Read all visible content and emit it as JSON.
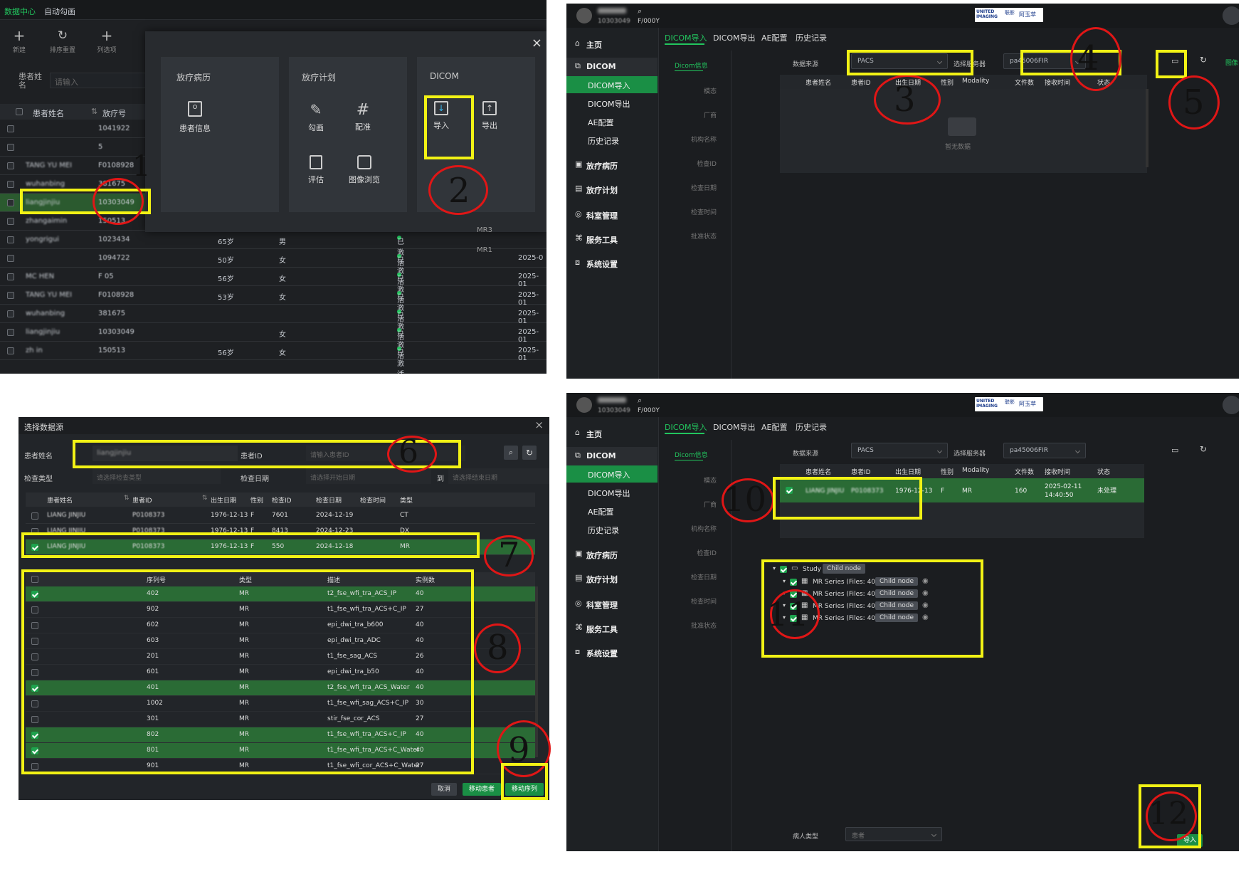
{
  "panel1": {
    "top_tabs": [
      "数据中心",
      "自动勾画"
    ],
    "toolbar": [
      "新建",
      "排序重置",
      "列选项"
    ],
    "search_label": "患者姓名",
    "search_placeholder": "请输入",
    "headers": [
      "患者姓名",
      "放疗号"
    ],
    "rows": [
      {
        "id": "1041922"
      },
      {
        "id": "5"
      },
      {
        "name": "TANG YU MEI",
        "id": "F0108928"
      },
      {
        "name": "wuhanbing",
        "id": "381675"
      },
      {
        "name": "liangjinjiu",
        "id": "10303049"
      },
      {
        "name": "zhangaimin",
        "id": "150513"
      },
      {
        "name": "yongrigui",
        "id": "1023434",
        "age": "65岁",
        "sex": "男",
        "status": "已激活"
      },
      {
        "id": "1094722",
        "age": "50岁",
        "sex": "女",
        "status": "已激活",
        "date": "2025-0"
      },
      {
        "name": "MC HEN",
        "id": "F 05",
        "age": "56岁",
        "sex": "女",
        "status": "已激活",
        "date": "2025-01"
      },
      {
        "name": "TANG YU MEI",
        "id": "F0108928",
        "age": "53岁",
        "sex": "女",
        "status": "已激活",
        "date": "2025-01"
      },
      {
        "name": "wuhanbing",
        "id": "381675",
        "status": "已激活",
        "date": "2025-01"
      },
      {
        "name": "liangjinjiu",
        "id": "10303049",
        "sex": "女",
        "status": "已激活",
        "date": "2025-01"
      },
      {
        "name": "zh in",
        "id": "150513",
        "age": "56岁",
        "sex": "女",
        "status": "已激活",
        "date": "2025-01"
      }
    ],
    "mr_labels": [
      "MR3",
      "MR1"
    ],
    "modal": {
      "close": "×",
      "sections": [
        {
          "title": "放疗病历",
          "items": [
            "患者信息"
          ]
        },
        {
          "title": "放疗计划",
          "items": [
            "勾画",
            "配准",
            "评估",
            "图像浏览"
          ]
        },
        {
          "title": "DICOM",
          "items": [
            "导入",
            "导出"
          ]
        }
      ]
    }
  },
  "app": {
    "user_sub": "10303049",
    "user_sub2": "F/000Y",
    "logo_brand": "UNITED IMAGING",
    "logo_cn": "联影",
    "logo_right": "阿玉苹",
    "nav": [
      "主页",
      "DICOM",
      "DICOM导入",
      "DICOM导出",
      "AE配置",
      "历史记录",
      "放疗病历",
      "放疗计划",
      "科室管理",
      "服务工具",
      "系统设置"
    ],
    "tabs": [
      "DICOM导入",
      "DICOM导出",
      "AE配置",
      "历史记录"
    ],
    "side_tab": "Dicom信息",
    "side_fields": [
      "模态",
      "厂商",
      "机构名称",
      "检查ID",
      "检查日期",
      "检查时间",
      "批准状态"
    ],
    "source_label": "数据来源",
    "source_value": "PACS",
    "server_label": "选择服务器",
    "server_value": "pa45006FIR",
    "right_label": "图像",
    "table_headers": [
      "患者姓名",
      "患者ID",
      "出生日期",
      "性别",
      "Modality",
      "文件数",
      "接收时间",
      "状态"
    ],
    "empty_text": "暂无数据"
  },
  "panel4": {
    "row": {
      "name": "LIANG JINJIU",
      "id": "P0108373",
      "birth": "1976-12-13",
      "sex": "F",
      "modality": "MR",
      "files": "160",
      "recv": "2025-02-11\n14:40:50",
      "status": "未处理"
    },
    "tree": {
      "study": "Study",
      "child": "Child node",
      "series": [
        "MR Series (Files: 40)",
        "MR Series (Files: 40)",
        "MR Series (Files: 40)",
        "MR Series (Files: 40)"
      ]
    },
    "patient_type_label": "病人类型",
    "patient_type_value": "患者",
    "import_button": "导入"
  },
  "dialog": {
    "title": "选择数据源",
    "close": "×",
    "name_label": "患者姓名",
    "name_value": "liangjinjiu",
    "id_label": "患者ID",
    "id_placeholder": "请输入患者ID",
    "type_label": "检查类型",
    "type_placeholder": "请选择检查类型",
    "date_label": "检查日期",
    "date_start": "请选择开始日期",
    "date_to": "到",
    "date_end": "请选择结束日期",
    "study_headers": [
      "患者姓名",
      "患者ID",
      "出生日期",
      "性别",
      "检查ID",
      "检查日期",
      "检查时间",
      "类型"
    ],
    "studies": [
      {
        "name": "LIANG JINJIU",
        "id": "P0108373",
        "birth": "1976-12-13",
        "sex": "F",
        "exam": "7601",
        "date": "2024-12-19",
        "type": "CT",
        "checked": false
      },
      {
        "name": "LIANG JINJIU",
        "id": "P0108373",
        "birth": "1976-12-13",
        "sex": "F",
        "exam": "8413",
        "date": "2024-12-23",
        "type": "DX",
        "checked": false
      },
      {
        "name": "LIANG JINJIU",
        "id": "P0108373",
        "birth": "1976-12-13",
        "sex": "F",
        "exam": "550",
        "date": "2024-12-18",
        "type": "MR",
        "checked": true
      }
    ],
    "series_headers": [
      "序列号",
      "类型",
      "描述",
      "实例数"
    ],
    "series": [
      {
        "no": "402",
        "type": "MR",
        "desc": "t2_fse_wfi_tra_ACS_IP",
        "count": "40",
        "checked": true
      },
      {
        "no": "902",
        "type": "MR",
        "desc": "t1_fse_wfi_tra_ACS+C_IP",
        "count": "27",
        "checked": false
      },
      {
        "no": "602",
        "type": "MR",
        "desc": "epi_dwi_tra_b600",
        "count": "40",
        "checked": false
      },
      {
        "no": "603",
        "type": "MR",
        "desc": "epi_dwi_tra_ADC",
        "count": "40",
        "checked": false
      },
      {
        "no": "201",
        "type": "MR",
        "desc": "t1_fse_sag_ACS",
        "count": "26",
        "checked": false
      },
      {
        "no": "601",
        "type": "MR",
        "desc": "epi_dwi_tra_b50",
        "count": "40",
        "checked": false
      },
      {
        "no": "401",
        "type": "MR",
        "desc": "t2_fse_wfi_tra_ACS_Water",
        "count": "40",
        "checked": true
      },
      {
        "no": "1002",
        "type": "MR",
        "desc": "t1_fse_wfi_sag_ACS+C_IP",
        "count": "30",
        "checked": false
      },
      {
        "no": "301",
        "type": "MR",
        "desc": "stir_fse_cor_ACS",
        "count": "27",
        "checked": false
      },
      {
        "no": "802",
        "type": "MR",
        "desc": "t1_fse_wfi_tra_ACS+C_IP",
        "count": "40",
        "checked": true
      },
      {
        "no": "801",
        "type": "MR",
        "desc": "t1_fse_wfi_tra_ACS+C_Water",
        "count": "40",
        "checked": true
      },
      {
        "no": "901",
        "type": "MR",
        "desc": "t1_fse_wfi_cor_ACS+C_Water",
        "count": "27",
        "checked": false
      }
    ],
    "buttons": [
      "取消",
      "移动患者",
      "移动序列"
    ]
  },
  "annotations": [
    "1",
    "2",
    "3",
    "4",
    "5",
    "6",
    "7",
    "8",
    "9",
    "10",
    "11",
    "12"
  ],
  "colors": {
    "accent_green": "#22c55e",
    "highlight_yellow": "#f2f215",
    "annotation_red": "#e01616",
    "bg_dark": "#1b1d20"
  }
}
